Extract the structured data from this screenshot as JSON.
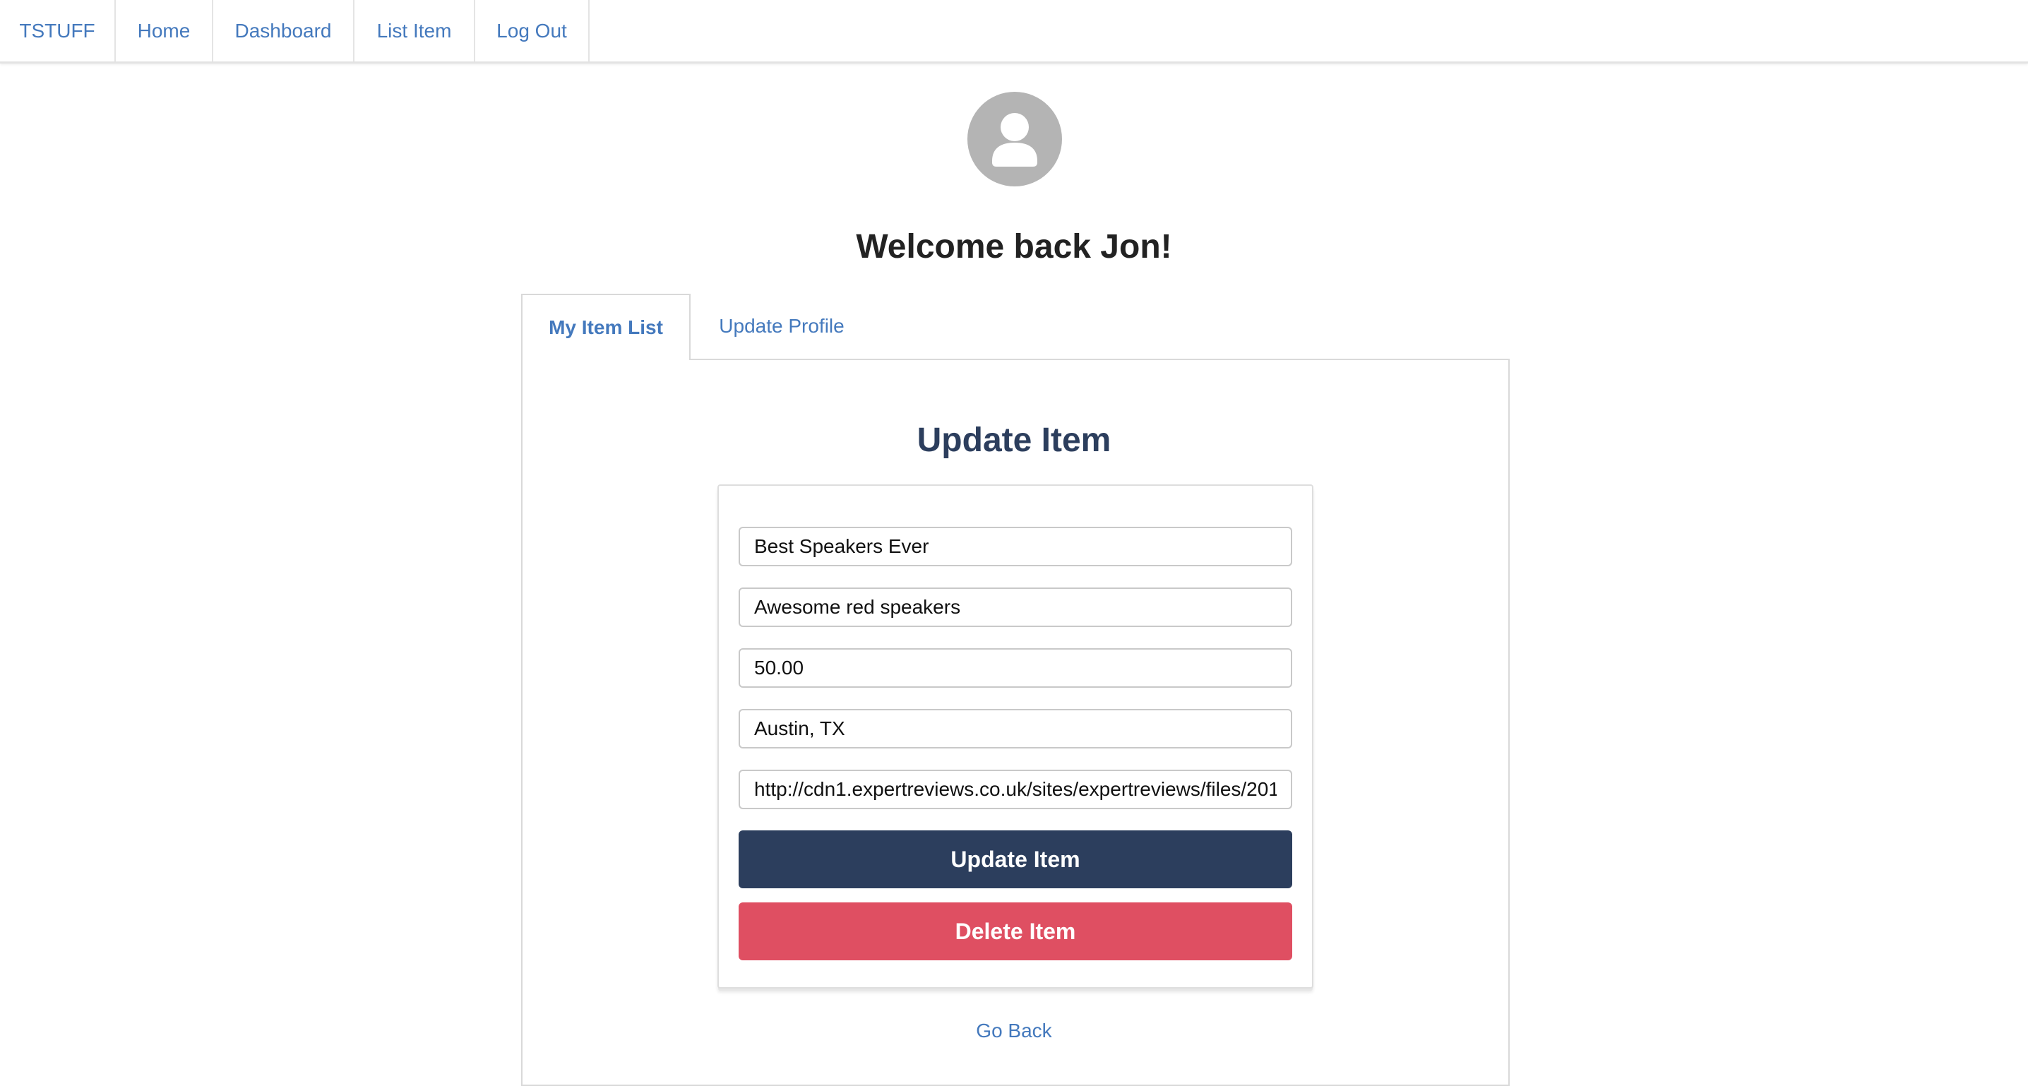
{
  "nav": {
    "brand": "TSTUFF",
    "items": [
      {
        "label": "Home"
      },
      {
        "label": "Dashboard"
      },
      {
        "label": "List Item"
      },
      {
        "label": "Log Out"
      }
    ]
  },
  "profile": {
    "avatar_icon": "user-avatar-icon",
    "welcome": "Welcome back Jon!"
  },
  "tabs": [
    {
      "label": "My Item List",
      "active": true
    },
    {
      "label": "Update Profile",
      "active": false
    }
  ],
  "form": {
    "title": "Update Item",
    "fields": {
      "name": "Best Speakers Ever",
      "description": "Awesome red speakers",
      "price": "50.00",
      "location": "Austin, TX",
      "image_url": "http://cdn1.expertreviews.co.uk/sites/expertreviews/files/201"
    },
    "update_label": "Update Item",
    "delete_label": "Delete Item",
    "go_back_label": "Go Back"
  },
  "colors": {
    "link": "#4479bd",
    "primary": "#2c3e5d",
    "danger": "#df4f62",
    "avatar": "#b4b4b4"
  }
}
